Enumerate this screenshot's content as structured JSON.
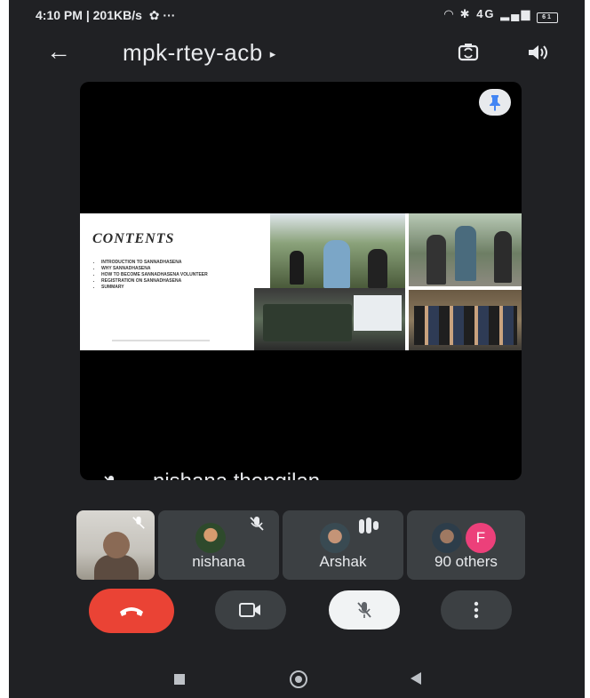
{
  "status_bar": {
    "time": "4:10 PM",
    "speed": "201KB/s",
    "extra": "···",
    "signal": "4G",
    "battery": "61"
  },
  "app_bar": {
    "meeting_code": "mpk-rtey-acb",
    "arrow": "▸"
  },
  "stage": {
    "speaker_name": "nishana thengilan",
    "slide": {
      "heading": "CONTENTS",
      "items": [
        "INTRODUCTION TO SANNADHASENA",
        "WHY SANNADHASENA",
        "HOW TO BECOME SANNADHASENA VOLUNTEER",
        "REGISTRATION ON SANNADHASENA",
        "SUMMARY"
      ]
    }
  },
  "participants": [
    {
      "name": "nishana",
      "muted": true
    },
    {
      "name": "Arshak",
      "speaking": true
    },
    {
      "name": "90 others",
      "letter": "F"
    }
  ],
  "colors": {
    "background": "#202124",
    "tile": "#3c4043",
    "end_call": "#ea4335",
    "accent_avatar": "#ec407a"
  },
  "icons": {
    "back": "arrow-left-icon",
    "switch_camera": "switch-camera-icon",
    "speaker": "volume-icon",
    "pin": "pin-icon",
    "mic_off": "mic-off-icon",
    "camera": "videocam-icon",
    "end_call": "call-end-icon",
    "more": "more-vert-icon"
  }
}
